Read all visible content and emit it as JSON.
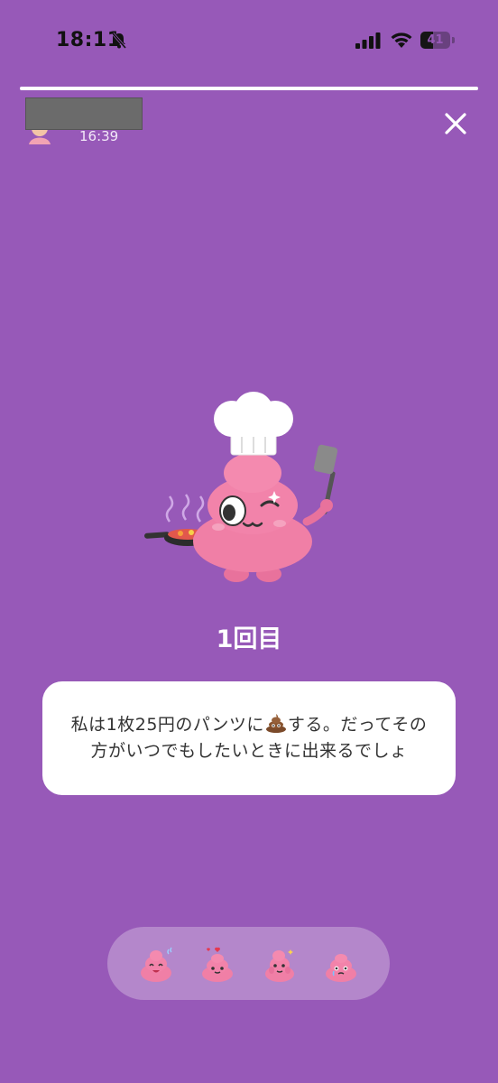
{
  "status_bar": {
    "time": "18:11",
    "battery": "41",
    "battery_level": 0.41
  },
  "story": {
    "progress": 1.0,
    "posted_time": "16:39",
    "count_label": "1回目",
    "message_before": "私は1枚25円のパンツに",
    "message_after": "する。だってその方がいつでもしたいときに出来るでしょ",
    "message_emoji": "poop-emoji"
  },
  "reactions": [
    {
      "icon": "poop-laugh-icon"
    },
    {
      "icon": "poop-love-icon"
    },
    {
      "icon": "poop-blush-icon"
    },
    {
      "icon": "poop-cry-icon"
    }
  ],
  "colors": {
    "background": "#9759b8",
    "mascot_pink": "#f07fa6",
    "bubble": "#ffffff"
  }
}
